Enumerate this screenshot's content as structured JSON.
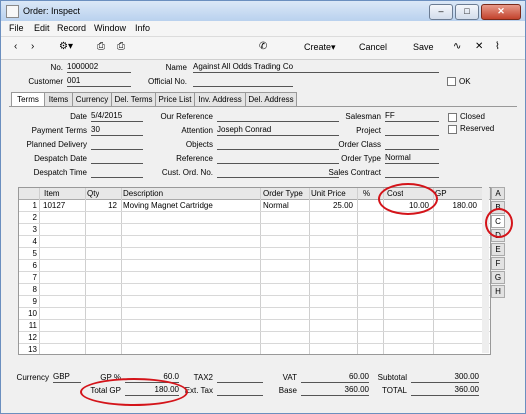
{
  "window": {
    "title": "Order: Inspect"
  },
  "menu": [
    "File",
    "Edit",
    "Record",
    "Window",
    "Info"
  ],
  "toolbar": {
    "create": "Create",
    "cancel": "Cancel",
    "save": "Save"
  },
  "header": {
    "no_label": "No.",
    "no_value": "1000002",
    "name_label": "Name",
    "name_value": "Against All Odds Trading Co",
    "customer_label": "Customer",
    "customer_value": "001",
    "official_label": "Official No.",
    "official_value": "",
    "ok_label": "OK"
  },
  "tabs": [
    "Terms",
    "Items",
    "Currency",
    "Del. Terms",
    "Price List",
    "Inv. Address",
    "Del. Address"
  ],
  "terms": {
    "date_label": "Date",
    "date_value": "5/4/2015",
    "payterms_label": "Payment Terms",
    "payterms_value": "30",
    "planned_label": "Planned Delivery",
    "planned_value": "",
    "despdate_label": "Despatch Date",
    "despdate_value": "",
    "desptime_label": "Despatch Time",
    "desptime_value": "",
    "ourref_label": "Our Reference",
    "ourref_value": "",
    "attention_label": "Attention",
    "attention_value": "Joseph Conrad",
    "objects_label": "Objects",
    "objects_value": "",
    "reference_label": "Reference",
    "reference_value": "",
    "custord_label": "Cust. Ord. No.",
    "custord_value": "",
    "salesman_label": "Salesman",
    "salesman_value": "FF",
    "project_label": "Project",
    "project_value": "",
    "orderclass_label": "Order Class",
    "orderclass_value": "",
    "ordertype_label": "Order Type",
    "ordertype_value": "Normal",
    "salescontract_label": "Sales Contract",
    "salescontract_value": "",
    "closed_label": "Closed",
    "reserved_label": "Reserved"
  },
  "grid": {
    "columns": [
      "Item",
      "Qty",
      "Description",
      "Order Type",
      "Unit Price",
      "%",
      "Cost",
      "GP"
    ],
    "row1": {
      "n": "1",
      "item": "10127",
      "qty": "12",
      "desc": "Moving Magnet Cartridge",
      "otype": "Normal",
      "price": "25.00",
      "pct": "",
      "cost": "10.00",
      "gp": "180.00"
    },
    "rownums": [
      "2",
      "3",
      "4",
      "5",
      "6",
      "7",
      "8",
      "9",
      "10",
      "11",
      "12",
      "13"
    ],
    "side_tabs": [
      "A",
      "B",
      "C",
      "D",
      "E",
      "F",
      "G",
      "H"
    ]
  },
  "footer": {
    "currency_label": "Currency",
    "currency_value": "GBP",
    "gppct_label": "GP %",
    "gppct_value": "60.0",
    "totalgp_label": "Total GP",
    "totalgp_value": "180.00",
    "tax2_label": "TAX2",
    "tax2_value": "",
    "exttax_label": "Ext. Tax",
    "exttax_value": "",
    "vat_label": "VAT",
    "vat_value": "60.00",
    "base_label": "Base",
    "base_value": "360.00",
    "subtotal_label": "Subtotal",
    "subtotal_value": "300.00",
    "total_label": "TOTAL",
    "total_value": "360.00"
  },
  "colors": {
    "highlight": "#d4141a",
    "title_bar": "#b9d1ee"
  },
  "icons": [
    "back-arrow-icon",
    "forward-arrow-icon",
    "gear-icon",
    "print-icon",
    "print-preview-icon",
    "phone-icon",
    "activity-icon",
    "expand-icon",
    "paperclip-icon"
  ]
}
